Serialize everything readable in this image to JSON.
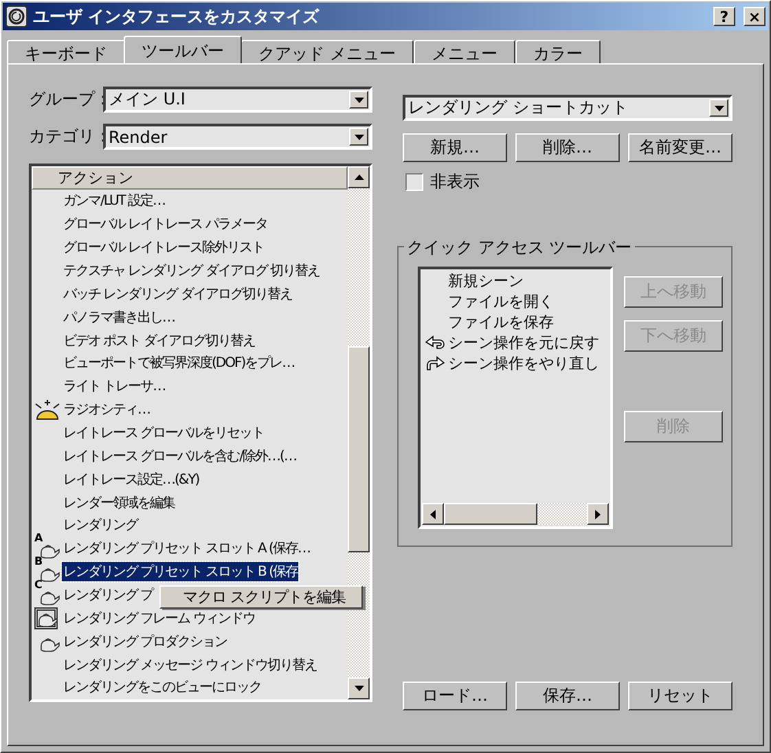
{
  "window": {
    "title": "ユーザ インタフェースをカスタマイズ",
    "buttons": [
      "?",
      "×"
    ]
  },
  "tabs": [
    {
      "label": "キーボード",
      "selected": false
    },
    {
      "label": "ツールバー",
      "selected": true
    },
    {
      "label": "クアッド メニュー",
      "selected": false
    },
    {
      "label": "メニュー",
      "selected": false
    },
    {
      "label": "カラー",
      "selected": false
    }
  ],
  "group": {
    "label": "グループ :",
    "value": "メイン U.I"
  },
  "category": {
    "label": "カテゴリ :",
    "value": "Render"
  },
  "action_list": {
    "header": "アクション",
    "items": [
      {
        "label": "ガンマ/LUT 設定…",
        "selected": false
      },
      {
        "label": "グローバル レイトレース パラメータ",
        "selected": false
      },
      {
        "label": "グローバル レイトレース除外リスト",
        "selected": false
      },
      {
        "label": "テクスチャ レンダリング ダイアログ 切り替え",
        "selected": false
      },
      {
        "label": "バッチ レンダリング ダイアログ切り替え",
        "selected": false
      },
      {
        "label": "パノラマ書き出し…",
        "selected": false
      },
      {
        "label": "ビデオ ポスト ダイアログ切り替え",
        "selected": false
      },
      {
        "label": "ビューポートで被写界深度(DOF)をプレ…",
        "selected": false
      },
      {
        "label": "ライト トレーサ…",
        "selected": false
      },
      {
        "label": "ラジオシティ…",
        "kind": "light",
        "selected": false
      },
      {
        "label": "レイトレース グローバルをリセット",
        "selected": false
      },
      {
        "label": "レイトレース グローバルを含む/除外…(…",
        "selected": false
      },
      {
        "label": "レイトレース設定…(&Y)",
        "selected": false
      },
      {
        "label": "レンダー領域を編集",
        "selected": false
      },
      {
        "label": "レンダリング",
        "selected": false
      },
      {
        "label": "レンダリング プリセット スロット A (保存…",
        "kind": "teapot",
        "badge": "A",
        "selected": false
      },
      {
        "label": "レンダリング プリセット スロット B (保存",
        "kind": "teapot",
        "badge": "B",
        "selected": true
      },
      {
        "label": "レンダリング プ",
        "kind": "teapot",
        "badge": "C",
        "selected": false
      },
      {
        "label": "レンダリング フレーム ウィンドウ",
        "kind": "frame",
        "selected": false
      },
      {
        "label": "レンダリング プロダクション",
        "kind": "teapot",
        "selected": false
      },
      {
        "label": "レンダリング メッセージ ウィンドウ切り替え",
        "selected": false
      },
      {
        "label": "レンダリングをこのビューにロック",
        "selected": false
      }
    ]
  },
  "context_menu": {
    "items": [
      "マクロ スクリプトを編集"
    ]
  },
  "toolbar_select": {
    "value": "レンダリング ショートカット"
  },
  "toolbar_buttons": [
    "新規…",
    "削除…",
    "名前変更…"
  ],
  "hide_checkbox": {
    "label": "非表示",
    "checked": false
  },
  "quick_access": {
    "title": "クイック アクセス ツールバー",
    "items": [
      {
        "label": "新規シーン"
      },
      {
        "label": "ファイルを開く"
      },
      {
        "label": "ファイルを保存"
      },
      {
        "label": "シーン操作を元に戻す",
        "kind": "undo"
      },
      {
        "label": "シーン操作をやり直し",
        "kind": "redo"
      }
    ],
    "buttons": [
      {
        "label": "上へ移動",
        "disabled": true
      },
      {
        "label": "下へ移動",
        "disabled": true
      },
      {
        "label": "削除",
        "disabled": true
      }
    ]
  },
  "bottom_buttons": [
    "ロード…",
    "保存…",
    "リセット"
  ]
}
